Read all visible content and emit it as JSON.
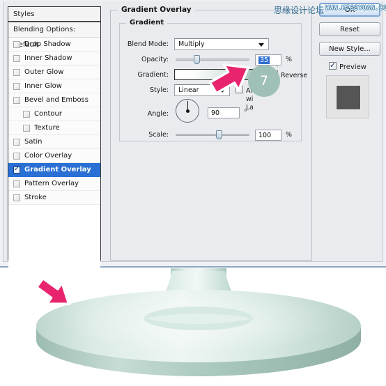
{
  "dialog": {
    "styles_panel": {
      "header": "Styles",
      "blending_options": "Blending Options: Default",
      "items": [
        {
          "label": "Drop Shadow",
          "checked": false,
          "indent": false,
          "selected": false
        },
        {
          "label": "Inner Shadow",
          "checked": false,
          "indent": false,
          "selected": false
        },
        {
          "label": "Outer Glow",
          "checked": false,
          "indent": false,
          "selected": false
        },
        {
          "label": "Inner Glow",
          "checked": false,
          "indent": false,
          "selected": false
        },
        {
          "label": "Bevel and Emboss",
          "checked": false,
          "indent": false,
          "selected": false
        },
        {
          "label": "Contour",
          "checked": false,
          "indent": true,
          "selected": false
        },
        {
          "label": "Texture",
          "checked": false,
          "indent": true,
          "selected": false
        },
        {
          "label": "Satin",
          "checked": false,
          "indent": false,
          "selected": false
        },
        {
          "label": "Color Overlay",
          "checked": false,
          "indent": false,
          "selected": false
        },
        {
          "label": "Gradient Overlay",
          "checked": true,
          "indent": false,
          "selected": true
        },
        {
          "label": "Pattern Overlay",
          "checked": false,
          "indent": false,
          "selected": false
        },
        {
          "label": "Stroke",
          "checked": false,
          "indent": false,
          "selected": false
        }
      ]
    },
    "gradient_overlay": {
      "group_title": "Gradient Overlay",
      "subgroup_title": "Gradient",
      "blend_mode": {
        "label": "Blend Mode:",
        "value": "Multiply"
      },
      "opacity": {
        "label": "Opacity:",
        "value": "35",
        "unit": "%"
      },
      "gradient": {
        "label": "Gradient:",
        "reverse_label": "Reverse",
        "reverse_checked": true,
        "stops": [
          "#ffffff",
          "#a9c6bc"
        ]
      },
      "style": {
        "label": "Style:",
        "value": "Linear",
        "align_label": "Align with Layer",
        "align_checked": true
      },
      "angle": {
        "label": "Angle:",
        "value": "90",
        "unit": "°"
      },
      "scale": {
        "label": "Scale:",
        "value": "100",
        "unit": "%"
      }
    },
    "buttons": {
      "ok": "OK",
      "reset": "Reset",
      "new_style": "New Style...",
      "preview_label": "Preview",
      "preview_checked": true
    }
  },
  "watermark": {
    "chinese": "思缘设计论坛",
    "english": "WWW.MISSYUAN.COM"
  },
  "annotations": {
    "step_number": "7"
  },
  "colors": {
    "selection_blue": "#2a6fd4",
    "badge_teal": "#9fc0b7",
    "arrow_pink": "#e8246e",
    "object_mint": "#cfe3dc",
    "dialog_bg": "#e9ebef"
  }
}
